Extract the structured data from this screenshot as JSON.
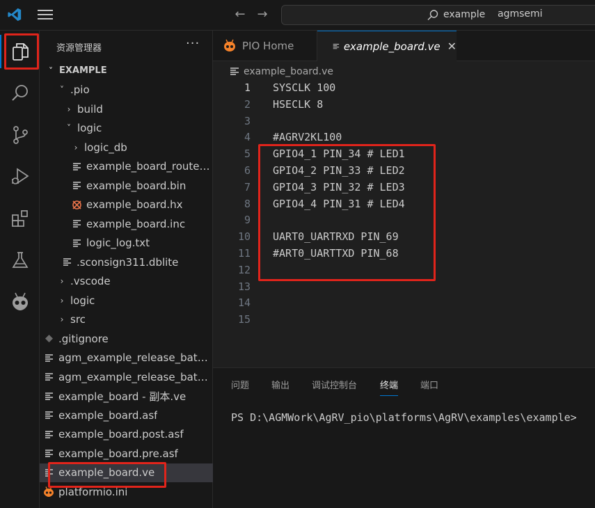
{
  "search": {
    "label": "example",
    "project": "agmsemi"
  },
  "sidebar": {
    "title": "资源管理器",
    "more": "···",
    "items": [
      {
        "label": "EXAMPLE",
        "chev": "˅",
        "icon": "none"
      },
      {
        "label": ".pio",
        "chev": "˅",
        "icon": "none"
      },
      {
        "label": "build",
        "chev": "›",
        "icon": "none"
      },
      {
        "label": "logic",
        "chev": "˅",
        "icon": "none"
      },
      {
        "label": "logic_db",
        "chev": "›",
        "icon": "none"
      },
      {
        "label": "example_board_routed.v",
        "chev": "",
        "icon": "lines-icon"
      },
      {
        "label": "example_board.bin",
        "chev": "",
        "icon": "lines-icon"
      },
      {
        "label": "example_board.hx",
        "chev": "",
        "icon": "x-file-icon"
      },
      {
        "label": "example_board.inc",
        "chev": "",
        "icon": "lines-icon"
      },
      {
        "label": "logic_log.txt",
        "chev": "",
        "icon": "lines-icon"
      },
      {
        "label": ".sconsign311.dblite",
        "chev": "",
        "icon": "lines-icon"
      },
      {
        "label": ".vscode",
        "chev": "›",
        "icon": "none"
      },
      {
        "label": "logic",
        "chev": "›",
        "icon": "none"
      },
      {
        "label": "src",
        "chev": "›",
        "icon": "none"
      },
      {
        "label": ".gitignore",
        "chev": "",
        "icon": "git-icon"
      },
      {
        "label": "agm_example_release_batc...",
        "chev": "",
        "icon": "lines-icon"
      },
      {
        "label": "agm_example_release_batc...",
        "chev": "",
        "icon": "lines-icon"
      },
      {
        "label": "example_board - 副本.ve",
        "chev": "",
        "icon": "lines-icon"
      },
      {
        "label": "example_board.asf",
        "chev": "",
        "icon": "lines-icon"
      },
      {
        "label": "example_board.post.asf",
        "chev": "",
        "icon": "lines-icon"
      },
      {
        "label": "example_board.pre.asf",
        "chev": "",
        "icon": "lines-icon"
      },
      {
        "label": "example_board.ve",
        "chev": "",
        "icon": "lines-icon"
      },
      {
        "label": "platformio.ini",
        "chev": "",
        "icon": "pio-icon"
      }
    ]
  },
  "tabs": {
    "home": "PIO Home",
    "file": "example_board.ve",
    "close": "✕"
  },
  "breadcrumb": "example_board.ve",
  "editor": {
    "lines": [
      {
        "num": "1",
        "text": "SYSCLK 100"
      },
      {
        "num": "2",
        "text": "HSECLK 8"
      },
      {
        "num": "3",
        "text": ""
      },
      {
        "num": "4",
        "text": "#AGRV2KL100"
      },
      {
        "num": "5",
        "text": "GPIO4_1 PIN_34 # LED1"
      },
      {
        "num": "6",
        "text": "GPIO4_2 PIN_33 # LED2"
      },
      {
        "num": "7",
        "text": "GPIO4_3 PIN_32 # LED3"
      },
      {
        "num": "8",
        "text": "GPIO4_4 PIN_31 # LED4"
      },
      {
        "num": "9",
        "text": ""
      },
      {
        "num": "10",
        "text": "UART0_UARTRXD PIN_69"
      },
      {
        "num": "11",
        "text": "#ART0_UARTTXD PIN_68"
      },
      {
        "num": "12",
        "text": ""
      },
      {
        "num": "13",
        "text": ""
      },
      {
        "num": "14",
        "text": ""
      },
      {
        "num": "15",
        "text": ""
      }
    ]
  },
  "panel": {
    "tabs": [
      "问题",
      "输出",
      "调试控制台",
      "终端",
      "端口"
    ],
    "terminal": "PS D:\\AGMWork\\AgRV_pio\\platforms\\AgRV\\examples\\example>"
  },
  "colors": {
    "accent": "#0078d4",
    "highlight": "#e0241b",
    "pio_orange": "#f5822a"
  }
}
